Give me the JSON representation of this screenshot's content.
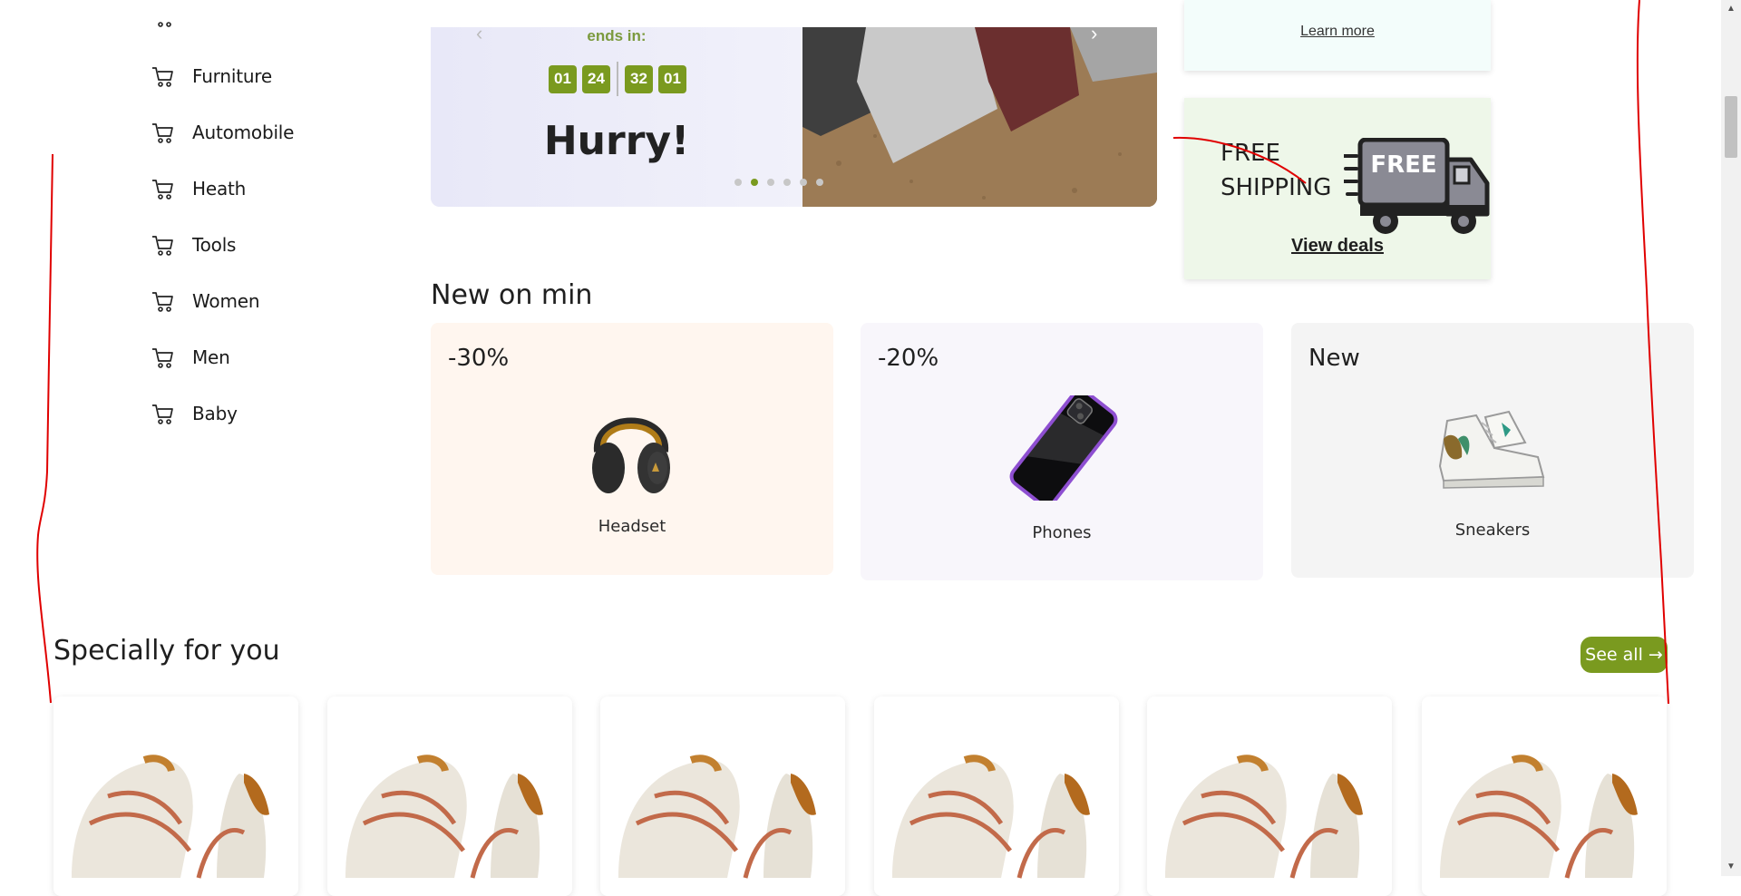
{
  "sidebar": {
    "items": [
      {
        "label": "Furniture",
        "icon": "cart-icon"
      },
      {
        "label": "Automobile",
        "icon": "cart-icon"
      },
      {
        "label": "Heath",
        "icon": "cart-icon"
      },
      {
        "label": "Tools",
        "icon": "cart-icon"
      },
      {
        "label": "Women",
        "icon": "cart-icon"
      },
      {
        "label": "Men",
        "icon": "cart-icon"
      },
      {
        "label": "Baby",
        "icon": "cart-icon"
      }
    ]
  },
  "hero": {
    "ends_in": "ends in:",
    "timer": [
      "01",
      "24",
      "32",
      "01"
    ],
    "headline": "Hurry!",
    "slide_count": 6,
    "active_slide": 2
  },
  "promos": {
    "top_link": "Learn more",
    "free_shipping_line1": "FREE",
    "free_shipping_line2": "SHIPPING",
    "truck_text": "FREE",
    "view_deals": "View deals"
  },
  "new_on_min": {
    "title": "New on min",
    "cards": [
      {
        "badge": "-30%",
        "name": "Headset",
        "bg": "#fff6ef",
        "image": "headset-icon"
      },
      {
        "badge": "-20%",
        "name": "Phones",
        "bg": "#f8f6fb",
        "image": "phone-icon"
      },
      {
        "badge": "New",
        "name": "Sneakers",
        "bg": "#f4f4f4",
        "image": "sneakers-icon"
      }
    ]
  },
  "specially_for_you": {
    "title": "Specially for you",
    "see_all": "See all →",
    "product_count": 6
  },
  "colors": {
    "accent": "#7a9a1f",
    "annotation": "#e00000"
  }
}
